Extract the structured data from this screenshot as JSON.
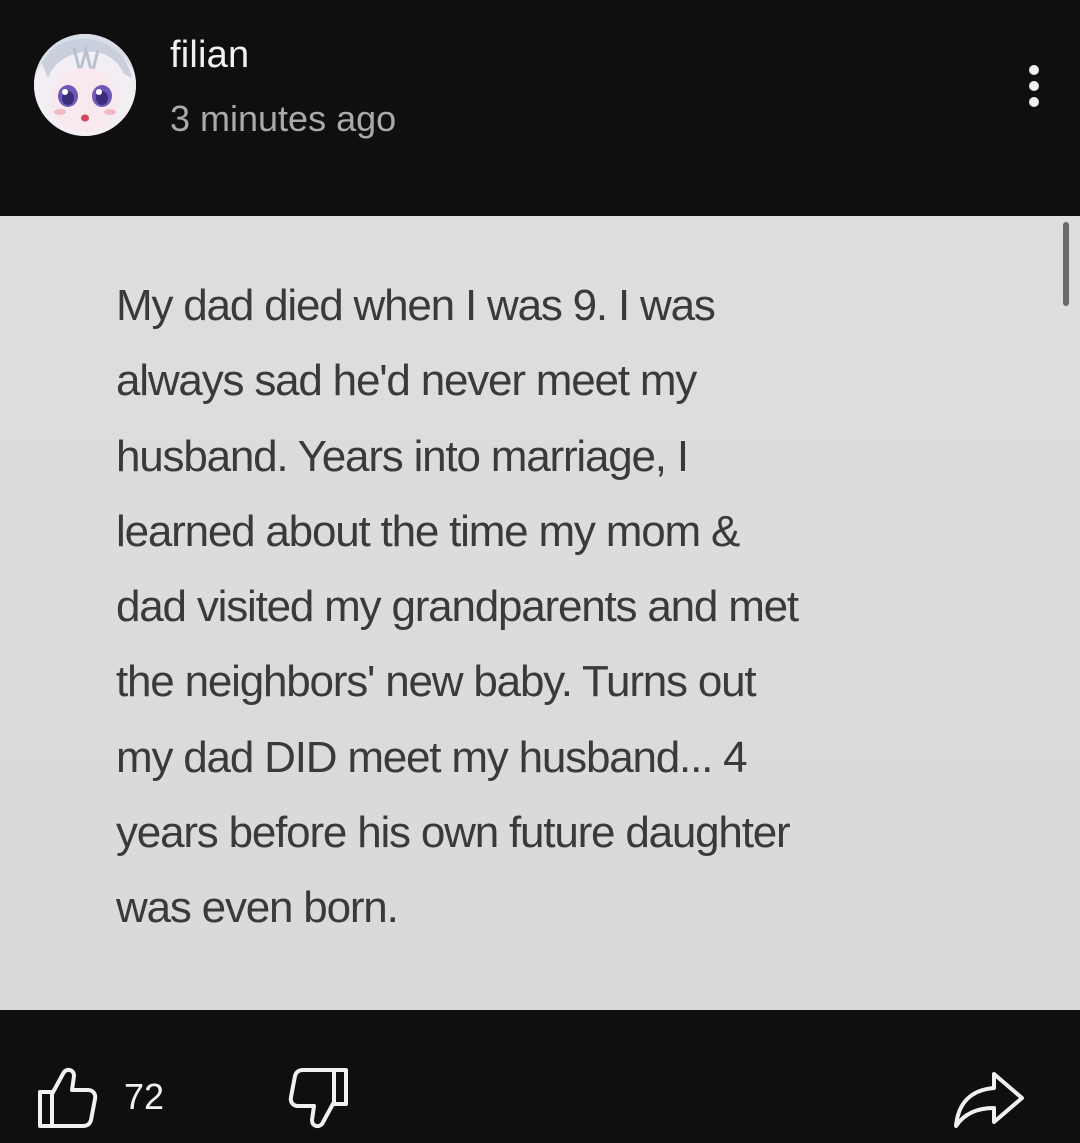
{
  "post": {
    "author": "filian",
    "timestamp": "3 minutes ago",
    "image_text": "My dad died when I was 9. I was\nalways sad he'd never meet my\nhusband. Years into marriage, I\nlearned about the time my mom &\ndad visited my grandparents and met\nthe neighbors' new baby. Turns out\nmy dad DID meet my husband... 4\nyears before his own future daughter\nwas even born."
  },
  "actions": {
    "like_count": "72"
  },
  "icons": {
    "more": "more-vertical-icon",
    "like": "thumbs-up-icon",
    "dislike": "thumbs-down-icon",
    "share": "share-icon"
  },
  "colors": {
    "background": "#0f0f0f",
    "text_primary": "#f1f1f1",
    "text_secondary": "#aaaaaa",
    "image_background": "#dcdcdc",
    "image_text": "#3a3a3a"
  }
}
